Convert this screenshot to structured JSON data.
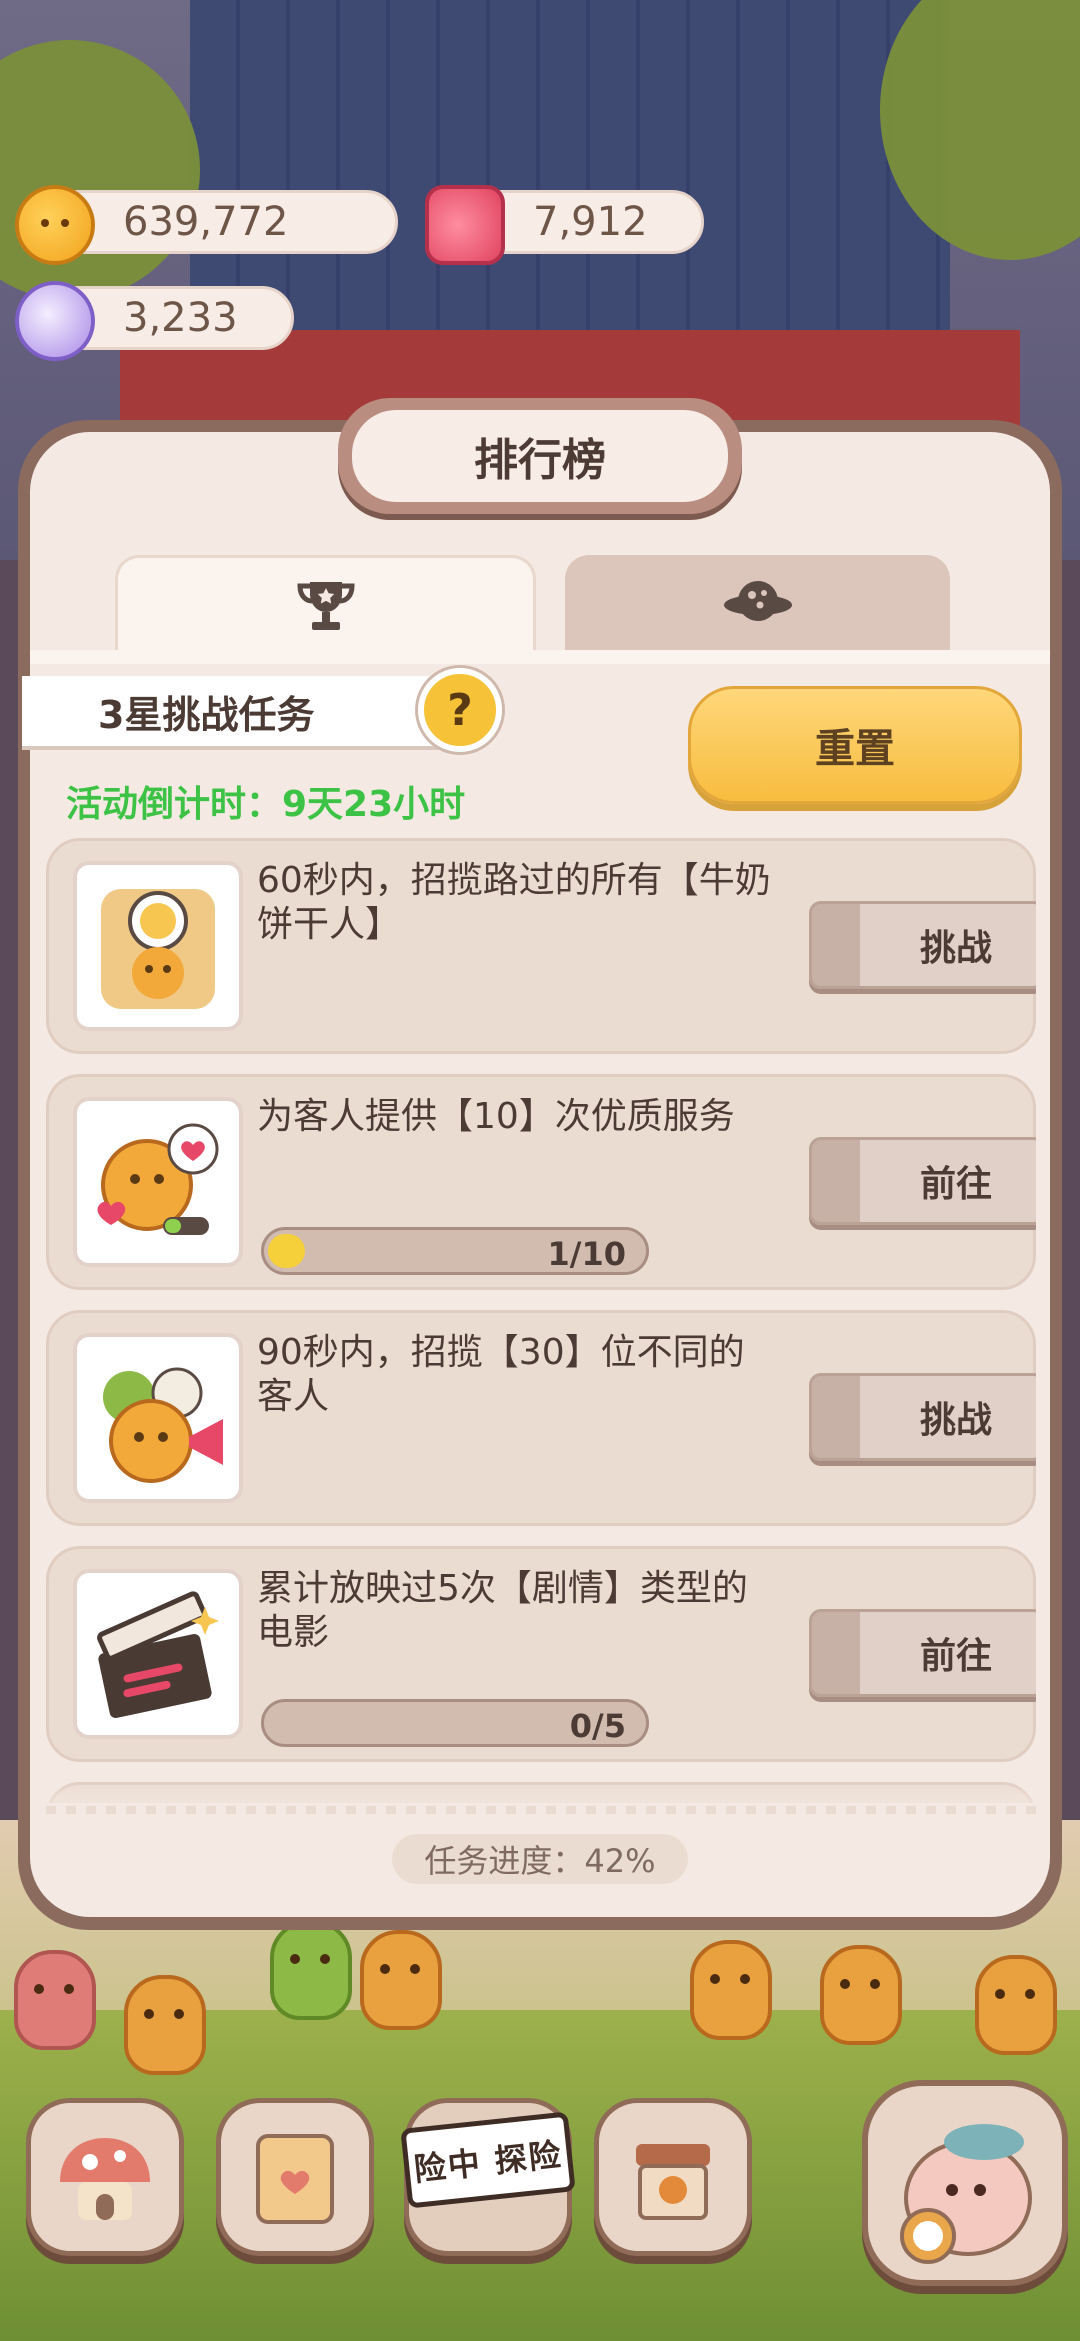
{
  "currencies": [
    {
      "id": "cookie-coins",
      "value": "639,772",
      "icon": "cookie-coin-icon"
    },
    {
      "id": "candles",
      "value": "7,912",
      "icon": "candle-icon"
    },
    {
      "id": "gems",
      "value": "3,233",
      "icon": "crystal-gem-icon"
    }
  ],
  "panel": {
    "title": "排行榜",
    "tabs": [
      {
        "icon": "trophy-icon",
        "active": true
      },
      {
        "icon": "planet-icon",
        "active": false
      }
    ],
    "task_group_title": "3星挑战任务",
    "help_symbol": "?",
    "countdown": "活动倒计时：9天23小时",
    "reset_label": "重置",
    "tasks": [
      {
        "text": "60秒内，招揽路过的所有【牛奶饼干人】",
        "button": "挑战",
        "icon": "milk-cookie-stopwatch-icon"
      },
      {
        "text": "为客人提供【10】次优质服务",
        "button": "前往",
        "icon": "cookie-heart-service-icon",
        "progress_text": "1/10",
        "progress_value": 0.1
      },
      {
        "text": "90秒内，招揽【30】位不同的客人",
        "button": "挑战",
        "icon": "cookie-crowd-megaphone-icon"
      },
      {
        "text": "累计放映过5次【剧情】类型的电影",
        "button": "前往",
        "icon": "clapperboard-icon",
        "progress_text": "0/5",
        "progress_value": 0
      }
    ],
    "overall_progress": "任务进度：42%"
  },
  "bottom_nav": {
    "items": [
      {
        "icon": "mushroom-house-icon"
      },
      {
        "icon": "notebook-heart-icon"
      },
      {
        "icon": "explore-banner-icon",
        "label": "险中 探险"
      },
      {
        "icon": "cafe-stand-icon"
      },
      {
        "icon": "fish-clock-pet-icon"
      }
    ]
  },
  "colors": {
    "panel_bg": "#f5eae3",
    "card_bg": "#ebdcd2",
    "accent_yellow": "#f7bd3f",
    "countdown_green": "#3cc244",
    "text_dark": "#4b3b34"
  }
}
